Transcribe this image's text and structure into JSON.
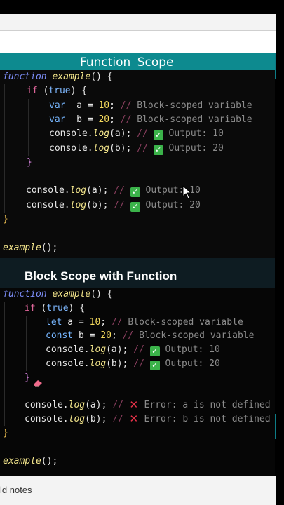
{
  "slide1": {
    "title": "Function  Scope",
    "lines": [
      [
        [
          "kw",
          "function "
        ],
        [
          "fn",
          "example"
        ],
        [
          "pl",
          "() {"
        ]
      ],
      [
        [
          "flow",
          "if "
        ],
        [
          "pl",
          "("
        ],
        [
          "bool",
          "true"
        ],
        [
          "pl",
          ") {"
        ]
      ],
      [
        [
          "decl",
          "var"
        ],
        [
          "pl",
          "  a = "
        ],
        [
          "num",
          "10"
        ],
        [
          "pl",
          "; "
        ],
        [
          "slash",
          "// "
        ],
        [
          "cmt",
          "Block-scoped variable"
        ]
      ],
      [
        [
          "decl",
          "var"
        ],
        [
          "pl",
          "  b = "
        ],
        [
          "num",
          "20"
        ],
        [
          "pl",
          "; "
        ],
        [
          "slash",
          "// "
        ],
        [
          "cmt",
          "Block-scoped variable"
        ]
      ],
      [
        [
          "pl",
          "console."
        ],
        [
          "fn",
          "log"
        ],
        [
          "pl",
          "(a); "
        ],
        [
          "slash",
          "// "
        ],
        [
          "chk",
          "✓"
        ],
        [
          "cmt",
          " Output: 10"
        ]
      ],
      [
        [
          "pl",
          "console."
        ],
        [
          "fn",
          "log"
        ],
        [
          "pl",
          "(b); "
        ],
        [
          "slash",
          "// "
        ],
        [
          "chk",
          "✓"
        ],
        [
          "cmt",
          " Output: 20"
        ]
      ],
      [
        [
          "brace2",
          "}"
        ]
      ],
      [
        [
          "pl",
          ""
        ]
      ],
      [
        [
          "pl",
          "console."
        ],
        [
          "fn",
          "log"
        ],
        [
          "pl",
          "(a); "
        ],
        [
          "slash",
          "// "
        ],
        [
          "chk",
          "✓"
        ],
        [
          "cmt",
          " Output: 10"
        ]
      ],
      [
        [
          "pl",
          "console."
        ],
        [
          "fn",
          "log"
        ],
        [
          "pl",
          "(b); "
        ],
        [
          "slash",
          "// "
        ],
        [
          "chk",
          "✓"
        ],
        [
          "cmt",
          " Output: 20"
        ]
      ],
      [
        [
          "brace",
          "}"
        ]
      ],
      [
        [
          "pl",
          ""
        ]
      ],
      [
        [
          "fn",
          "example"
        ],
        [
          "pl",
          "();"
        ]
      ]
    ]
  },
  "slide2": {
    "title": "Block Scope with Function",
    "lines": [
      [
        [
          "kw",
          "function "
        ],
        [
          "fn",
          "example"
        ],
        [
          "pl",
          "() {"
        ]
      ],
      [
        [
          "flow",
          "if "
        ],
        [
          "pl",
          "("
        ],
        [
          "bool",
          "true"
        ],
        [
          "pl",
          ") {"
        ]
      ],
      [
        [
          "decl",
          "let"
        ],
        [
          "pl",
          " a = "
        ],
        [
          "num",
          "10"
        ],
        [
          "pl",
          "; "
        ],
        [
          "slash",
          "// "
        ],
        [
          "cmt",
          "Block-scoped variable"
        ]
      ],
      [
        [
          "decl",
          "const"
        ],
        [
          "pl",
          " b = "
        ],
        [
          "num",
          "20"
        ],
        [
          "pl",
          "; "
        ],
        [
          "slash",
          "// "
        ],
        [
          "cmt",
          "Block-scoped variable"
        ]
      ],
      [
        [
          "pl",
          "console."
        ],
        [
          "fn",
          "log"
        ],
        [
          "pl",
          "(a); "
        ],
        [
          "slash",
          "// "
        ],
        [
          "chk",
          "✓"
        ],
        [
          "cmt",
          " Output: 10"
        ]
      ],
      [
        [
          "pl",
          "console."
        ],
        [
          "fn",
          "log"
        ],
        [
          "pl",
          "(b); "
        ],
        [
          "slash",
          "// "
        ],
        [
          "chk",
          "✓"
        ],
        [
          "cmt",
          " Output: 20"
        ]
      ],
      [
        [
          "brace2",
          "}"
        ]
      ],
      [
        [
          "pl",
          ""
        ]
      ],
      [
        [
          "pl",
          "console."
        ],
        [
          "fn",
          "log"
        ],
        [
          "pl",
          "(a); "
        ],
        [
          "slash",
          "// "
        ],
        [
          "x",
          "✕"
        ],
        [
          "cmt",
          " Error: a is not defined"
        ]
      ],
      [
        [
          "pl",
          "console."
        ],
        [
          "fn",
          "log"
        ],
        [
          "pl",
          "(b); "
        ],
        [
          "slash",
          "// "
        ],
        [
          "x",
          "✕"
        ],
        [
          "cmt",
          " Error: b is not defined"
        ]
      ],
      [
        [
          "brace",
          "}"
        ]
      ],
      [
        [
          "pl",
          ""
        ]
      ],
      [
        [
          "fn",
          "example"
        ],
        [
          "pl",
          "();"
        ]
      ]
    ]
  },
  "bottom": {
    "notes_label": "ld notes"
  },
  "icons": {
    "check": "check-icon",
    "cross": "cross-icon",
    "cursor": "mouse-pointer-icon",
    "eraser": "eraser-icon"
  },
  "colors": {
    "title_bar": "#0d8a8f",
    "keyword": "#7b8cf5",
    "function_name": "#f3e58b",
    "number": "#f7dc5e",
    "comment": "#8b8b8b",
    "check": "#3bb34a",
    "error": "#e8334a"
  }
}
